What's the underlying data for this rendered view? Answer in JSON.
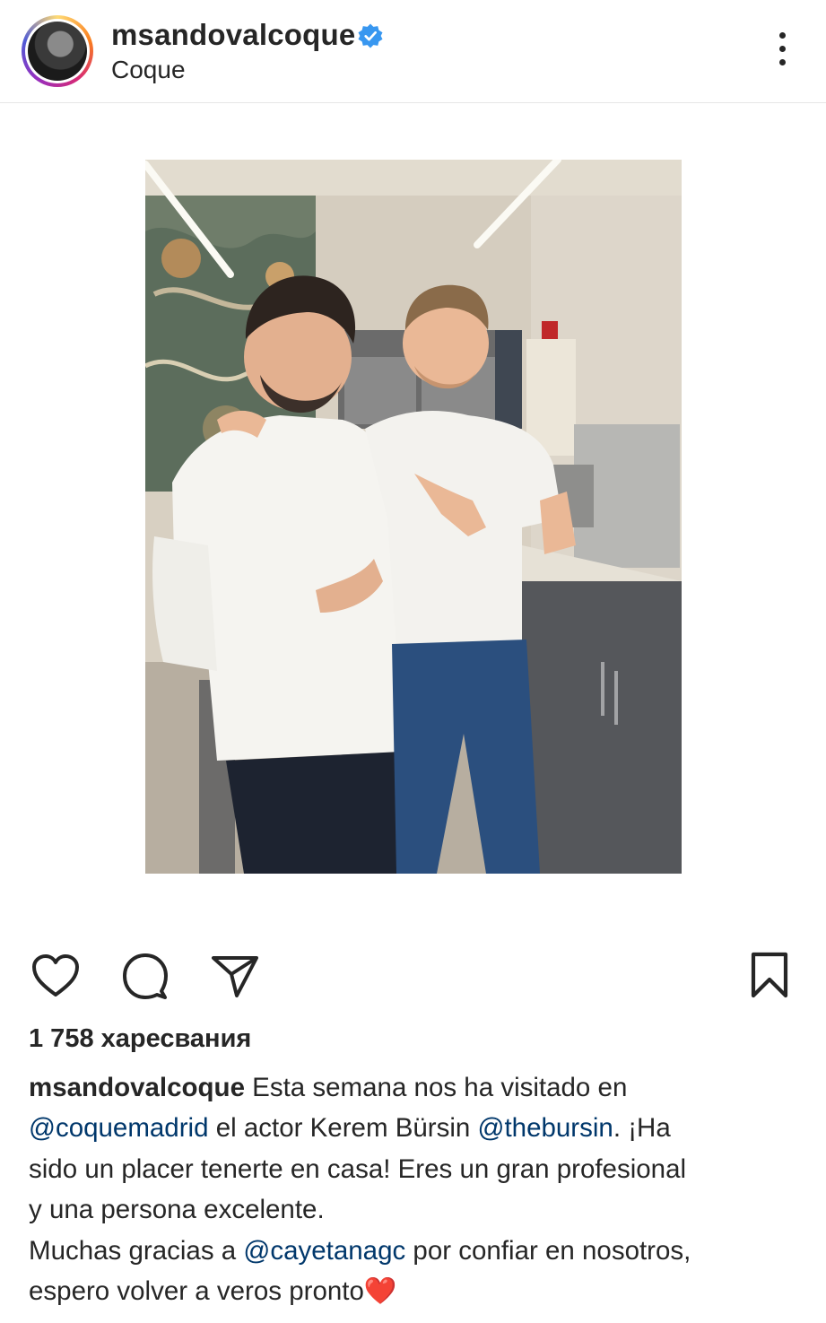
{
  "header": {
    "username": "msandovalcoque",
    "subtitle": "Coque",
    "verified": true,
    "icons": [
      "avatar",
      "verified-badge-icon",
      "more-options-icon"
    ],
    "colors": {
      "verified": "#3897f0",
      "text": "#262626"
    }
  },
  "post": {
    "image_description_icon": "photo"
  },
  "actions": {
    "icons": [
      "heart-icon",
      "comment-icon",
      "share-icon",
      "bookmark-icon"
    ]
  },
  "likes": "1 758 харесвания",
  "caption": {
    "username": "msandovalcoque",
    "line1_text": " Esta semana nos ha visitado en",
    "mention1": "@coquemadrid",
    "line2_mid": " el actor Kerem Bürsin ",
    "mention2": "@thebursin",
    "line2_end": ". ¡Ha",
    "line3": "sido un placer tenerte en casa! Eres un gran profesional",
    "line4": "y una persona excelente.",
    "line5_start": "Muchas gracias a ",
    "mention3": "@cayetanagc",
    "line5_end": " por confiar en nosotros,",
    "line6": "espero volver a veros pronto",
    "heart_emoji": "❤️",
    "colors": {
      "mention": "#00376b"
    }
  }
}
